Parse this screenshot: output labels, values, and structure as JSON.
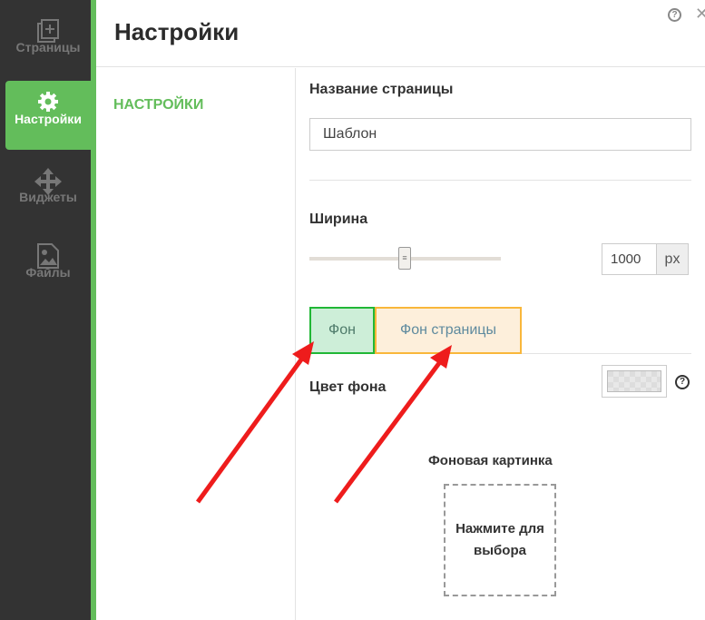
{
  "sidebar": {
    "items": [
      {
        "label": "Страницы",
        "icon": "pages-add-icon"
      },
      {
        "label": "Настройки",
        "icon": "gear-icon",
        "active": true
      },
      {
        "label": "Виджеты",
        "icon": "move-icon"
      },
      {
        "label": "Файлы",
        "icon": "image-file-icon"
      }
    ]
  },
  "header": {
    "title": "Настройки"
  },
  "left_panel": {
    "title": "НАСТРОЙКИ"
  },
  "form": {
    "page_name_label": "Название страницы",
    "page_name_value": "Шаблон",
    "width_label": "Ширина",
    "width_value": "1000",
    "width_unit": "px",
    "width_slider_fraction": 0.5,
    "tabs": [
      {
        "label": "Фон"
      },
      {
        "label": "Фон страницы"
      }
    ],
    "bg_color_label": "Цвет фона",
    "bg_image_label": "Фоновая картинка",
    "bg_image_drop": "Нажмите для выбора"
  },
  "colors": {
    "accent": "#63bd5b",
    "sidebar": "#333333",
    "arrow": "#ee1c1c"
  }
}
